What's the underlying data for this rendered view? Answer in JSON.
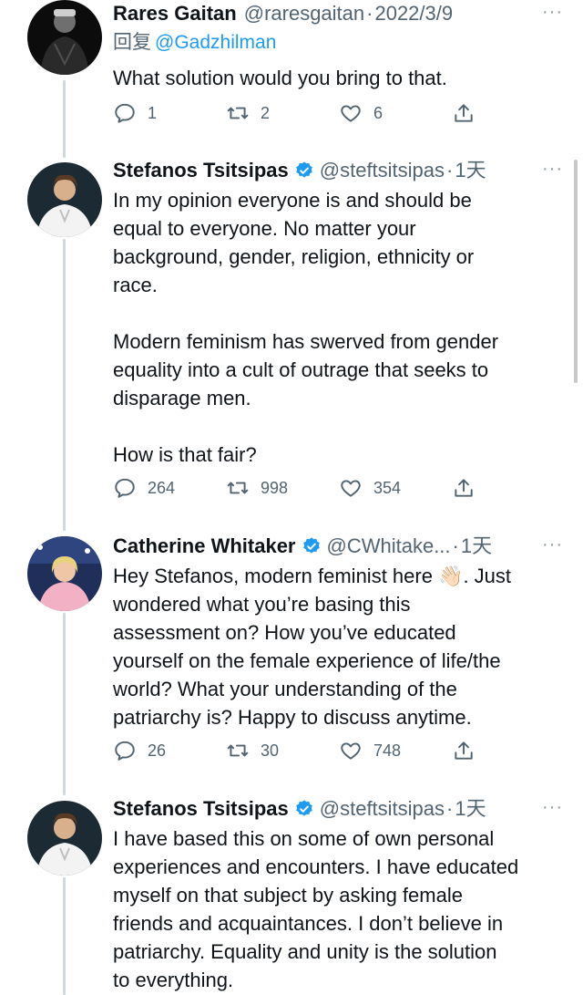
{
  "tweets": [
    {
      "name": "Rares Gaitan",
      "handle": "@raresgaitan",
      "sep": "·",
      "time": "2022/3/9",
      "reply_prefix": "回复",
      "reply_to": "@Gadzhilman",
      "body": "What solution would you bring to that.",
      "replies": "1",
      "retweets": "2",
      "likes": "6",
      "more": "···"
    },
    {
      "name": "Stefanos Tsitsipas",
      "handle": "@steftsitsipas",
      "sep": "·",
      "time": "1天",
      "body": "In my opinion everyone is and should be\nequal to everyone. No matter your\nbackground, gender, religion, ethnicity or\nrace.\n\nModern feminism has swerved from gender\nequality into a cult of outrage that seeks to\ndisparage men.\n\nHow is that fair?",
      "replies": "264",
      "retweets": "998",
      "likes": "354",
      "more": "···"
    },
    {
      "name": "Catherine Whitaker",
      "handle": "@CWhitake...",
      "sep": "·",
      "time": "1天",
      "body": "Hey Stefanos, modern feminist here 👋🏻. Just\nwondered what you’re basing this\nassessment on? How you’ve educated\nyourself on the female experience of life/the\nworld? What your understanding of the\npatriarchy is? Happy to discuss anytime.",
      "replies": "26",
      "retweets": "30",
      "likes": "748",
      "more": "···"
    },
    {
      "name": "Stefanos Tsitsipas",
      "handle": "@steftsitsipas",
      "sep": "·",
      "time": "1天",
      "body": "I have based this on some of own personal\nexperiences and encounters. I have educated\nmyself on that subject by asking female\nfriends and acquaintances. I don’t believe in\npatriarchy. Equality and unity is the solution\nto everything.",
      "more": "···"
    }
  ],
  "icons": {
    "reply": "reply-icon",
    "retweet": "retweet-icon",
    "like": "heart-icon",
    "share": "share-icon",
    "verified": "verified-badge-icon"
  },
  "colors": {
    "link": "#1d9bf0",
    "muted": "#536471",
    "verified": "#1d9bf0",
    "thread_line": "#cfd9de"
  }
}
